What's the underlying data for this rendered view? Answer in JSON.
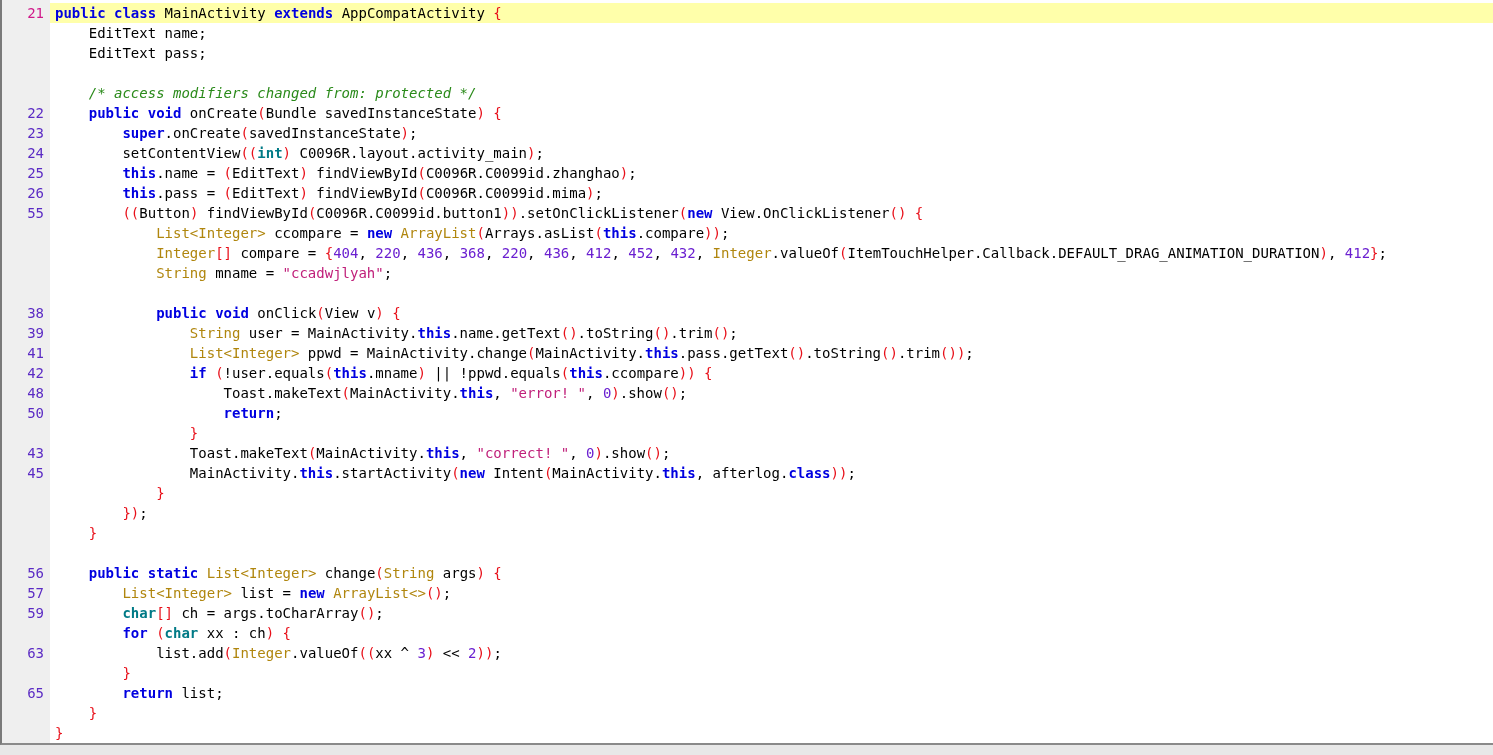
{
  "editor": {
    "lines": [
      {
        "number": "21",
        "current": true,
        "tokens": [
          {
            "kind": "kw",
            "text": "public "
          },
          {
            "kind": "kw",
            "text": "class"
          },
          {
            "kind": "plain",
            "text": " MainActivity "
          },
          {
            "kind": "kw",
            "text": "extends"
          },
          {
            "kind": "plain",
            "text": " AppCompatActivity "
          },
          {
            "kind": "punct",
            "text": "{"
          }
        ]
      },
      {
        "current": false,
        "tokens": [
          {
            "kind": "plain",
            "text": "    EditText name;"
          }
        ]
      },
      {
        "current": false,
        "tokens": [
          {
            "kind": "plain",
            "text": "    EditText pass;"
          }
        ]
      },
      {
        "current": false
      },
      {
        "current": false,
        "tokens": [
          {
            "kind": "comment",
            "text": "    /* access modifiers changed from: protected */"
          }
        ]
      },
      {
        "number": "22",
        "current": false,
        "tokens": [
          {
            "kind": "kw",
            "text": "    public "
          },
          {
            "kind": "kw",
            "text": "void"
          },
          {
            "kind": "plain",
            "text": " onCreate"
          },
          {
            "kind": "punct",
            "text": "("
          },
          {
            "kind": "plain",
            "text": "Bundle savedInstanceState"
          },
          {
            "kind": "punct",
            "text": ") {"
          }
        ]
      },
      {
        "number": "23",
        "current": false,
        "tokens": [
          {
            "kind": "kw",
            "text": "        super"
          },
          {
            "kind": "plain",
            "text": ".onCreate"
          },
          {
            "kind": "punct",
            "text": "("
          },
          {
            "kind": "plain",
            "text": "savedInstanceState"
          },
          {
            "kind": "punct",
            "text": ")"
          },
          {
            "kind": "plain",
            "text": ";"
          }
        ]
      },
      {
        "number": "24",
        "current": false,
        "tokens": [
          {
            "kind": "plain",
            "text": "        setContentView"
          },
          {
            "kind": "punct",
            "text": "(("
          },
          {
            "kind": "prim",
            "text": "int"
          },
          {
            "kind": "punct",
            "text": ")"
          },
          {
            "kind": "plain",
            "text": " C0096R.layout.activity_main"
          },
          {
            "kind": "punct",
            "text": ")"
          },
          {
            "kind": "plain",
            "text": ";"
          }
        ]
      },
      {
        "number": "25",
        "current": false,
        "tokens": [
          {
            "kind": "kw",
            "text": "        this"
          },
          {
            "kind": "plain",
            "text": ".name = "
          },
          {
            "kind": "punct",
            "text": "("
          },
          {
            "kind": "plain",
            "text": "EditText"
          },
          {
            "kind": "punct",
            "text": ")"
          },
          {
            "kind": "plain",
            "text": " findViewById"
          },
          {
            "kind": "punct",
            "text": "("
          },
          {
            "kind": "plain",
            "text": "C0096R.C0099id.zhanghao"
          },
          {
            "kind": "punct",
            "text": ")"
          },
          {
            "kind": "plain",
            "text": ";"
          }
        ]
      },
      {
        "number": "26",
        "current": false,
        "tokens": [
          {
            "kind": "kw",
            "text": "        this"
          },
          {
            "kind": "plain",
            "text": ".pass = "
          },
          {
            "kind": "punct",
            "text": "("
          },
          {
            "kind": "plain",
            "text": "EditText"
          },
          {
            "kind": "punct",
            "text": ")"
          },
          {
            "kind": "plain",
            "text": " findViewById"
          },
          {
            "kind": "punct",
            "text": "("
          },
          {
            "kind": "plain",
            "text": "C0096R.C0099id.mima"
          },
          {
            "kind": "punct",
            "text": ")"
          },
          {
            "kind": "plain",
            "text": ";"
          }
        ]
      },
      {
        "number": "55",
        "current": false,
        "tokens": [
          {
            "kind": "punct",
            "text": "        (("
          },
          {
            "kind": "plain",
            "text": "Button"
          },
          {
            "kind": "punct",
            "text": ")"
          },
          {
            "kind": "plain",
            "text": " findViewById"
          },
          {
            "kind": "punct",
            "text": "("
          },
          {
            "kind": "plain",
            "text": "C0096R.C0099id.button1"
          },
          {
            "kind": "punct",
            "text": "))"
          },
          {
            "kind": "plain",
            "text": ".setOnClickListener"
          },
          {
            "kind": "punct",
            "text": "("
          },
          {
            "kind": "kw",
            "text": "new"
          },
          {
            "kind": "plain",
            "text": " View.OnClickListener"
          },
          {
            "kind": "punct",
            "text": "() {"
          }
        ]
      },
      {
        "current": false,
        "tokens": [
          {
            "kind": "type",
            "text": "            List<Integer>"
          },
          {
            "kind": "plain",
            "text": " ccompare = "
          },
          {
            "kind": "kw",
            "text": "new "
          },
          {
            "kind": "type",
            "text": "ArrayList"
          },
          {
            "kind": "punct",
            "text": "("
          },
          {
            "kind": "plain",
            "text": "Arrays.asList"
          },
          {
            "kind": "punct",
            "text": "("
          },
          {
            "kind": "kw",
            "text": "this"
          },
          {
            "kind": "plain",
            "text": ".compare"
          },
          {
            "kind": "punct",
            "text": "))"
          },
          {
            "kind": "plain",
            "text": ";"
          }
        ]
      },
      {
        "current": false,
        "tokens": [
          {
            "kind": "type",
            "text": "            Integer"
          },
          {
            "kind": "punct",
            "text": "[]"
          },
          {
            "kind": "plain",
            "text": " compare = "
          },
          {
            "kind": "punct",
            "text": "{"
          },
          {
            "kind": "num",
            "text": "404"
          },
          {
            "kind": "plain",
            "text": ", "
          },
          {
            "kind": "num",
            "text": "220"
          },
          {
            "kind": "plain",
            "text": ", "
          },
          {
            "kind": "num",
            "text": "436"
          },
          {
            "kind": "plain",
            "text": ", "
          },
          {
            "kind": "num",
            "text": "368"
          },
          {
            "kind": "plain",
            "text": ", "
          },
          {
            "kind": "num",
            "text": "220"
          },
          {
            "kind": "plain",
            "text": ", "
          },
          {
            "kind": "num",
            "text": "436"
          },
          {
            "kind": "plain",
            "text": ", "
          },
          {
            "kind": "num",
            "text": "412"
          },
          {
            "kind": "plain",
            "text": ", "
          },
          {
            "kind": "num",
            "text": "452"
          },
          {
            "kind": "plain",
            "text": ", "
          },
          {
            "kind": "num",
            "text": "432"
          },
          {
            "kind": "plain",
            "text": ", "
          },
          {
            "kind": "type",
            "text": "Integer"
          },
          {
            "kind": "plain",
            "text": ".valueOf"
          },
          {
            "kind": "punct",
            "text": "("
          },
          {
            "kind": "plain",
            "text": "ItemTouchHelper.Callback.DEFAULT_DRAG_ANIMATION_DURATION"
          },
          {
            "kind": "punct",
            "text": ")"
          },
          {
            "kind": "plain",
            "text": ", "
          },
          {
            "kind": "num",
            "text": "412"
          },
          {
            "kind": "punct",
            "text": "}"
          },
          {
            "kind": "plain",
            "text": ";"
          }
        ]
      },
      {
        "current": false,
        "tokens": [
          {
            "kind": "type",
            "text": "            String"
          },
          {
            "kind": "plain",
            "text": " mname = "
          },
          {
            "kind": "str",
            "text": "\"ccadwjlyah\""
          },
          {
            "kind": "plain",
            "text": ";"
          }
        ]
      },
      {
        "current": false
      },
      {
        "number": "38",
        "current": false,
        "tokens": [
          {
            "kind": "kw",
            "text": "            public "
          },
          {
            "kind": "kw",
            "text": "void"
          },
          {
            "kind": "plain",
            "text": " onClick"
          },
          {
            "kind": "punct",
            "text": "("
          },
          {
            "kind": "plain",
            "text": "View v"
          },
          {
            "kind": "punct",
            "text": ") {"
          }
        ]
      },
      {
        "number": "39",
        "current": false,
        "tokens": [
          {
            "kind": "type",
            "text": "                String"
          },
          {
            "kind": "plain",
            "text": " user = MainActivity."
          },
          {
            "kind": "kw",
            "text": "this"
          },
          {
            "kind": "plain",
            "text": ".name.getText"
          },
          {
            "kind": "punct",
            "text": "()"
          },
          {
            "kind": "plain",
            "text": ".toString"
          },
          {
            "kind": "punct",
            "text": "()"
          },
          {
            "kind": "plain",
            "text": ".trim"
          },
          {
            "kind": "punct",
            "text": "()"
          },
          {
            "kind": "plain",
            "text": ";"
          }
        ]
      },
      {
        "number": "41",
        "current": false,
        "tokens": [
          {
            "kind": "type",
            "text": "                List<Integer>"
          },
          {
            "kind": "plain",
            "text": " ppwd = MainActivity.change"
          },
          {
            "kind": "punct",
            "text": "("
          },
          {
            "kind": "plain",
            "text": "MainActivity."
          },
          {
            "kind": "kw",
            "text": "this"
          },
          {
            "kind": "plain",
            "text": ".pass.getText"
          },
          {
            "kind": "punct",
            "text": "()"
          },
          {
            "kind": "plain",
            "text": ".toString"
          },
          {
            "kind": "punct",
            "text": "()"
          },
          {
            "kind": "plain",
            "text": ".trim"
          },
          {
            "kind": "punct",
            "text": "())"
          },
          {
            "kind": "plain",
            "text": ";"
          }
        ]
      },
      {
        "number": "42",
        "current": false,
        "tokens": [
          {
            "kind": "kw",
            "text": "                if"
          },
          {
            "kind": "punct",
            "text": " ("
          },
          {
            "kind": "plain",
            "text": "!user.equals"
          },
          {
            "kind": "punct",
            "text": "("
          },
          {
            "kind": "kw",
            "text": "this"
          },
          {
            "kind": "plain",
            "text": ".mname"
          },
          {
            "kind": "punct",
            "text": ")"
          },
          {
            "kind": "plain",
            "text": " || !ppwd.equals"
          },
          {
            "kind": "punct",
            "text": "("
          },
          {
            "kind": "kw",
            "text": "this"
          },
          {
            "kind": "plain",
            "text": ".ccompare"
          },
          {
            "kind": "punct",
            "text": ")) {"
          }
        ]
      },
      {
        "number": "48",
        "current": false,
        "tokens": [
          {
            "kind": "plain",
            "text": "                    Toast.makeText"
          },
          {
            "kind": "punct",
            "text": "("
          },
          {
            "kind": "plain",
            "text": "MainActivity."
          },
          {
            "kind": "kw",
            "text": "this"
          },
          {
            "kind": "plain",
            "text": ", "
          },
          {
            "kind": "str",
            "text": "\"error! \""
          },
          {
            "kind": "plain",
            "text": ", "
          },
          {
            "kind": "num",
            "text": "0"
          },
          {
            "kind": "punct",
            "text": ")"
          },
          {
            "kind": "plain",
            "text": ".show"
          },
          {
            "kind": "punct",
            "text": "()"
          },
          {
            "kind": "plain",
            "text": ";"
          }
        ]
      },
      {
        "number": "50",
        "current": false,
        "tokens": [
          {
            "kind": "kw",
            "text": "                    return"
          },
          {
            "kind": "plain",
            "text": ";"
          }
        ]
      },
      {
        "current": false,
        "tokens": [
          {
            "kind": "punct",
            "text": "                }"
          }
        ]
      },
      {
        "number": "43",
        "current": false,
        "tokens": [
          {
            "kind": "plain",
            "text": "                Toast.makeText"
          },
          {
            "kind": "punct",
            "text": "("
          },
          {
            "kind": "plain",
            "text": "MainActivity."
          },
          {
            "kind": "kw",
            "text": "this"
          },
          {
            "kind": "plain",
            "text": ", "
          },
          {
            "kind": "str",
            "text": "\"correct! \""
          },
          {
            "kind": "plain",
            "text": ", "
          },
          {
            "kind": "num",
            "text": "0"
          },
          {
            "kind": "punct",
            "text": ")"
          },
          {
            "kind": "plain",
            "text": ".show"
          },
          {
            "kind": "punct",
            "text": "()"
          },
          {
            "kind": "plain",
            "text": ";"
          }
        ]
      },
      {
        "number": "45",
        "current": false,
        "tokens": [
          {
            "kind": "plain",
            "text": "                MainActivity."
          },
          {
            "kind": "kw",
            "text": "this"
          },
          {
            "kind": "plain",
            "text": ".startActivity"
          },
          {
            "kind": "punct",
            "text": "("
          },
          {
            "kind": "kw",
            "text": "new"
          },
          {
            "kind": "plain",
            "text": " Intent"
          },
          {
            "kind": "punct",
            "text": "("
          },
          {
            "kind": "plain",
            "text": "MainActivity."
          },
          {
            "kind": "kw",
            "text": "this"
          },
          {
            "kind": "plain",
            "text": ", afterlog."
          },
          {
            "kind": "kw",
            "text": "class"
          },
          {
            "kind": "punct",
            "text": "))"
          },
          {
            "kind": "plain",
            "text": ";"
          }
        ]
      },
      {
        "current": false,
        "tokens": [
          {
            "kind": "punct",
            "text": "            }"
          }
        ]
      },
      {
        "current": false,
        "tokens": [
          {
            "kind": "punct",
            "text": "        })"
          },
          {
            "kind": "plain",
            "text": ";"
          }
        ]
      },
      {
        "current": false,
        "tokens": [
          {
            "kind": "punct",
            "text": "    }"
          }
        ]
      },
      {
        "current": false
      },
      {
        "number": "56",
        "current": false,
        "tokens": [
          {
            "kind": "kw",
            "text": "    public "
          },
          {
            "kind": "kw",
            "text": "static "
          },
          {
            "kind": "type",
            "text": "List<Integer>"
          },
          {
            "kind": "plain",
            "text": " change"
          },
          {
            "kind": "punct",
            "text": "("
          },
          {
            "kind": "type",
            "text": "String"
          },
          {
            "kind": "plain",
            "text": " args"
          },
          {
            "kind": "punct",
            "text": ") {"
          }
        ]
      },
      {
        "number": "57",
        "current": false,
        "tokens": [
          {
            "kind": "type",
            "text": "        List<Integer>"
          },
          {
            "kind": "plain",
            "text": " list = "
          },
          {
            "kind": "kw",
            "text": "new "
          },
          {
            "kind": "type",
            "text": "ArrayList<>"
          },
          {
            "kind": "punct",
            "text": "()"
          },
          {
            "kind": "plain",
            "text": ";"
          }
        ]
      },
      {
        "number": "59",
        "current": false,
        "tokens": [
          {
            "kind": "prim",
            "text": "        char"
          },
          {
            "kind": "punct",
            "text": "[]"
          },
          {
            "kind": "plain",
            "text": " ch = args.toCharArray"
          },
          {
            "kind": "punct",
            "text": "()"
          },
          {
            "kind": "plain",
            "text": ";"
          }
        ]
      },
      {
        "current": false,
        "tokens": [
          {
            "kind": "kw",
            "text": "        for"
          },
          {
            "kind": "punct",
            "text": " ("
          },
          {
            "kind": "prim",
            "text": "char"
          },
          {
            "kind": "plain",
            "text": " xx : ch"
          },
          {
            "kind": "punct",
            "text": ") {"
          }
        ]
      },
      {
        "number": "63",
        "current": false,
        "tokens": [
          {
            "kind": "plain",
            "text": "            list.add"
          },
          {
            "kind": "punct",
            "text": "("
          },
          {
            "kind": "type",
            "text": "Integer"
          },
          {
            "kind": "plain",
            "text": ".valueOf"
          },
          {
            "kind": "punct",
            "text": "(("
          },
          {
            "kind": "plain",
            "text": "xx ^ "
          },
          {
            "kind": "num",
            "text": "3"
          },
          {
            "kind": "punct",
            "text": ")"
          },
          {
            "kind": "plain",
            "text": " << "
          },
          {
            "kind": "num",
            "text": "2"
          },
          {
            "kind": "punct",
            "text": "))"
          },
          {
            "kind": "plain",
            "text": ";"
          }
        ]
      },
      {
        "current": false,
        "tokens": [
          {
            "kind": "punct",
            "text": "        }"
          }
        ]
      },
      {
        "number": "65",
        "current": false,
        "tokens": [
          {
            "kind": "kw",
            "text": "        return"
          },
          {
            "kind": "plain",
            "text": " list;"
          }
        ]
      },
      {
        "current": false,
        "tokens": [
          {
            "kind": "punct",
            "text": "    }"
          }
        ]
      },
      {
        "current": false,
        "tokens": [
          {
            "kind": "punct",
            "text": "}"
          }
        ]
      }
    ]
  }
}
